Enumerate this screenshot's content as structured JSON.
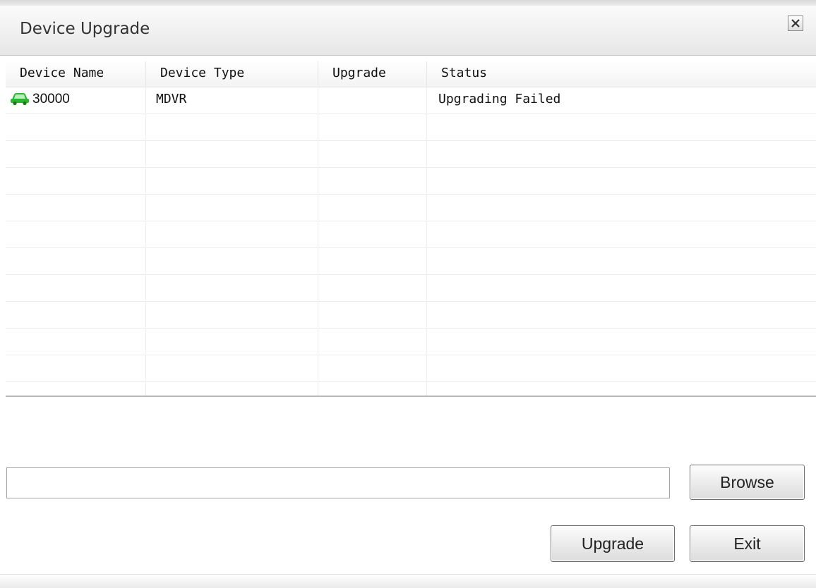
{
  "window": {
    "title": "Device Upgrade",
    "close_icon": "close-icon"
  },
  "table": {
    "columns": [
      "Device Name",
      "Device Type",
      "Upgrade",
      "Status"
    ],
    "rows": [
      {
        "icon": "car-icon",
        "icon_color": "#2db52d",
        "device_name": "30000",
        "device_type": "MDVR",
        "upgrade": "",
        "status": "Upgrading Failed"
      }
    ]
  },
  "file_path": {
    "value": "",
    "placeholder": ""
  },
  "buttons": {
    "browse": "Browse",
    "upgrade": "Upgrade",
    "exit": "Exit"
  }
}
